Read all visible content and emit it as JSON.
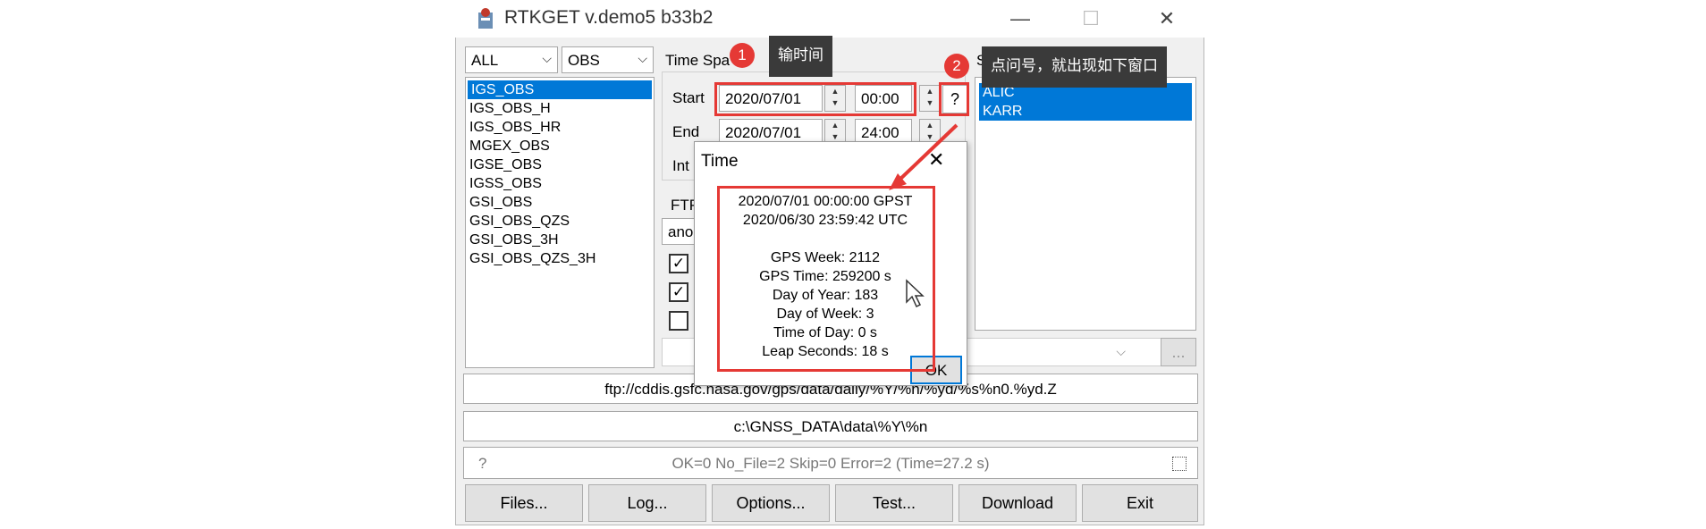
{
  "window": {
    "title": "RTKGET v.demo5 b33b2",
    "minimize": "—",
    "maximize": "☐",
    "close": "✕"
  },
  "filters": {
    "type": "ALL",
    "format": "OBS",
    "arrow": "⌵"
  },
  "data_types": [
    "IGS_OBS",
    "IGS_OBS_H",
    "IGS_OBS_HR",
    "MGEX_OBS",
    "IGSE_OBS",
    "IGSS_OBS",
    "GSI_OBS",
    "GSI_OBS_QZS",
    "GSI_OBS_3H",
    "GSI_OBS_QZS_3H"
  ],
  "time_span": {
    "header": "Time Spa",
    "start_label": "Start",
    "start_date": "2020/07/01",
    "start_time": "00:00",
    "end_label": "End",
    "end_date": "2020/07/01",
    "end_time": "24:00",
    "interval_label": "Int",
    "help_button": "?"
  },
  "ftp": {
    "label": "FTP",
    "login": "anor"
  },
  "checkboxes": [
    true,
    true,
    false
  ],
  "stations": {
    "header": "St",
    "items": [
      "ALIC",
      "KARR"
    ]
  },
  "url_field": "ftp://cddis.gsfc.nasa.gov/gps/data/daily/%Y/%n/%yd/%s%n0.%yd.Z",
  "dir_field": "c:\\GNSS_DATA\\data\\%Y\\%n",
  "status": {
    "help": "?",
    "text": "OK=0 No_File=2 Skip=0 Error=2 (Time=27.2 s)"
  },
  "extra_button": "...",
  "buttons": {
    "files": "Files...",
    "log": "Log...",
    "options": "Options...",
    "test": "Test...",
    "download": "Download",
    "exit": "Exit"
  },
  "time_dialog": {
    "title": "Time",
    "close": "✕",
    "lines": [
      "2020/07/01 00:00:00 GPST",
      "2020/06/30 23:59:42 UTC",
      "",
      "GPS Week: 2112",
      "GPS Time: 259200 s",
      "Day of Year: 183",
      "Day of Week: 3",
      "Time of Day: 0 s",
      "Leap Seconds: 18 s"
    ],
    "ok": "OK"
  },
  "annotations": [
    {
      "number": "1",
      "text": "输时间"
    },
    {
      "number": "2",
      "text": "点问号，就出现如下窗口"
    }
  ],
  "colors": {
    "accent_red": "#e53935",
    "selection": "#0078d7",
    "tooltip_bg": "#3a3a3a"
  }
}
